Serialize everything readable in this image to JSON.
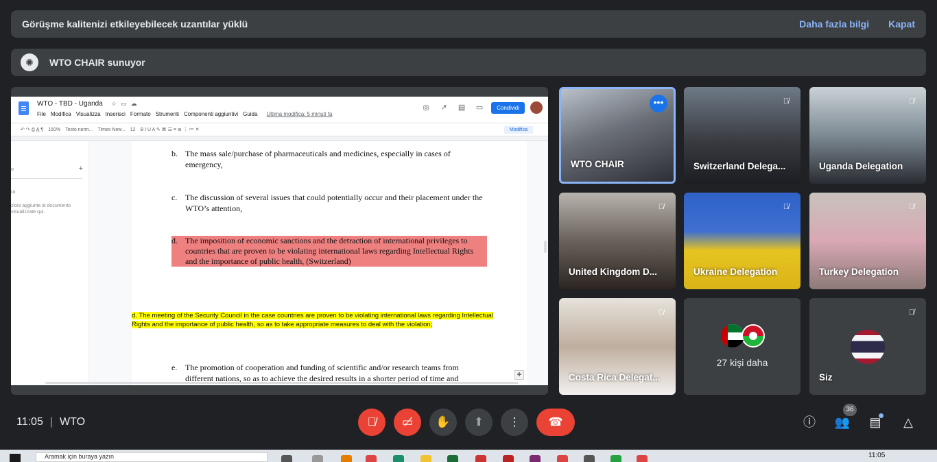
{
  "banner": {
    "message": "Görüşme kalitenizi etkileyebilecek uzantılar yüklü",
    "more_info": "Daha fazla bilgi",
    "close": "Kapat"
  },
  "presenter": {
    "label": "WTO CHAIR sunuyor"
  },
  "doc": {
    "title": "WTO - TBD - Uganda",
    "menu": [
      "File",
      "Modifica",
      "Visualizza",
      "Inserisci",
      "Formato",
      "Strumenti",
      "Componenti aggiuntivi",
      "Guida"
    ],
    "last_edit": "Ultima modifica: 5 minuti fa",
    "share_button": "Condividi",
    "toolbar": {
      "zoom": "150%",
      "style": "Testo norm...",
      "font": "Times New...",
      "size": "12",
      "mode": "Modifica"
    },
    "outline_heading": "o",
    "outline_r": "ra",
    "outline_hint": "zioni aggiunte al documento visualizzate qui.",
    "items": [
      {
        "letter": "b.",
        "text": "The mass sale/purchase of pharmaceuticals and medicines, especially in cases of emergency,"
      },
      {
        "letter": "c.",
        "text": "The discussion of several issues that could potentially occur and their placement under the WTO’s attention,"
      },
      {
        "letter": "d.",
        "text": "The imposition of economic sanctions and the detraction of international privileges to countries that are proven to be violating international laws regarding Intellectual Rights and the importance of public health, (Switzerland)"
      },
      {
        "letter": "e.",
        "text": "The promotion of cooperation and funding of scientific and/or research teams from different nations, so as to achieve the desired results in a shorter period of time and"
      }
    ],
    "yellow_text": "d. The meeting of the Security Council in the case  countries are proven to be violating international laws regarding Intellectual Rights and the importance of public health, so as to take appropriate measures to deal with the violation;"
  },
  "participants": [
    {
      "name": "WTO CHAIR"
    },
    {
      "name": "Switzerland Delega..."
    },
    {
      "name": "Uganda Delegation"
    },
    {
      "name": "United Kingdom D..."
    },
    {
      "name": "Ukraine Delegation"
    },
    {
      "name": "Turkey Delegation"
    },
    {
      "name": "Costa Rica Delegat..."
    },
    {
      "name": "Siz"
    }
  ],
  "more_people": "27 kişi daha",
  "bottom": {
    "time": "11:05",
    "meeting": "WTO",
    "people_count": "36"
  },
  "taskbar": {
    "search": "Aramak için buraya yazın",
    "time": "11:05"
  }
}
